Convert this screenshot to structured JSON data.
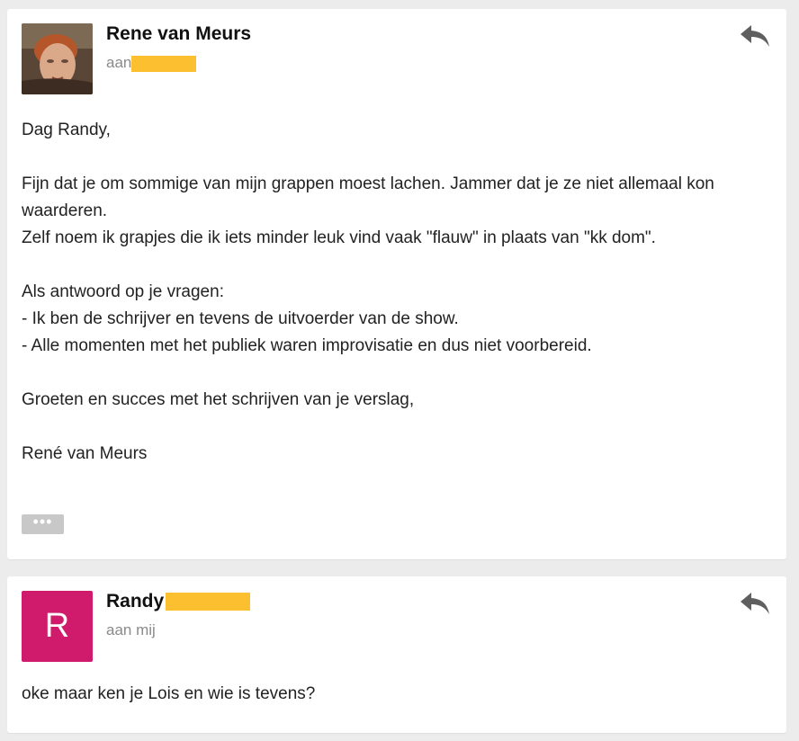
{
  "messages": [
    {
      "sender": "Rene van Meurs",
      "recipient_prefix": "aan",
      "redaction_color": "#FBBF2F",
      "lines": [
        "Dag Randy,",
        "",
        "Fijn dat je om sommige van mijn grappen moest lachen. Jammer dat je ze niet allemaal kon waarderen.",
        "Zelf noem ik grapjes die ik iets minder leuk vind vaak \"flauw\" in plaats van \"kk dom\".",
        "",
        "Als antwoord op je vragen:",
        "- Ik ben de schrijver en tevens de uitvoerder van de show.",
        "- Alle momenten met het publiek waren improvisatie en dus niet voorbereid.",
        "",
        "Groeten en succes met het schrijven van je verslag,",
        "",
        "René van Meurs"
      ],
      "more_label": "•••"
    },
    {
      "sender": "Randy",
      "avatar_letter": "R",
      "avatar_color": "#D01A6B",
      "recipient": "aan mij",
      "redaction_color": "#FBBF2F",
      "body": "oke maar ken je Lois en wie is tevens?"
    }
  ],
  "icons": {
    "reply": "reply-arrow-icon",
    "photo": "sender-photo",
    "more": "more-dots-icon"
  },
  "colors": {
    "page_bg": "#ECECEC",
    "card_bg": "#FFFFFF",
    "muted_text": "#8A8A8A"
  }
}
